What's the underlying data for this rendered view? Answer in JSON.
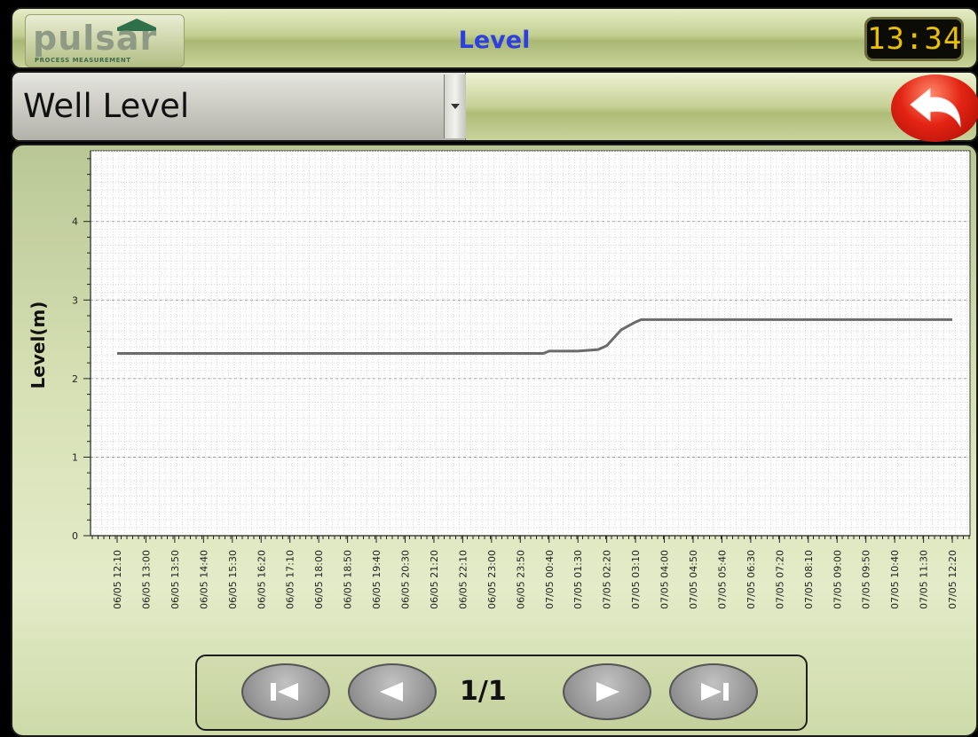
{
  "header": {
    "logo_text": "pulsar",
    "logo_subtext": "PROCESS MEASUREMENT",
    "title": "Level",
    "clock": "13:34"
  },
  "selector": {
    "selected": "Well Level"
  },
  "icons": {
    "dropdown": "chevron-down-icon",
    "back": "back-arrow-icon",
    "first": "skip-first-icon",
    "prev": "prev-icon",
    "next": "next-icon",
    "last": "skip-last-icon"
  },
  "pager": {
    "page": "1/1"
  },
  "colors": {
    "title": "#2e3fe0",
    "clock_digits": "#e8c000",
    "line": "#6b6b6b",
    "back_button": "#e32414"
  },
  "chart_data": {
    "type": "line",
    "ylabel": "Level(m)",
    "xlabel": "",
    "ylim": [
      0,
      4.9
    ],
    "yticks": [
      0,
      1,
      2,
      3,
      4
    ],
    "grid": true,
    "categories": [
      "06/05 12:10",
      "06/05 13:00",
      "06/05 13:50",
      "06/05 14:40",
      "06/05 15:30",
      "06/05 16:20",
      "06/05 17:10",
      "06/05 18:00",
      "06/05 18:50",
      "06/05 19:40",
      "06/05 20:30",
      "06/05 21:20",
      "06/05 22:10",
      "06/05 23:00",
      "06/05 23:50",
      "07/05 00:40",
      "07/05 01:30",
      "07/05 02:20",
      "07/05 03:10",
      "07/05 04:00",
      "07/05 04:50",
      "07/05 05:40",
      "07/05 06:30",
      "07/05 07:20",
      "07/05 08:10",
      "07/05 09:00",
      "07/05 09:50",
      "07/05 10:40",
      "07/05 11:30",
      "07/05 12:20"
    ],
    "series": [
      {
        "x": [
          "06/05 12:10",
          "06/05 23:50",
          "07/05 00:30",
          "07/05 00:40",
          "07/05 01:30",
          "07/05 02:05",
          "07/05 02:20",
          "07/05 02:45",
          "07/05 03:10",
          "07/05 03:20",
          "07/05 12:20"
        ],
        "values": [
          2.32,
          2.32,
          2.32,
          2.35,
          2.35,
          2.37,
          2.42,
          2.62,
          2.72,
          2.75,
          2.75
        ]
      }
    ]
  }
}
